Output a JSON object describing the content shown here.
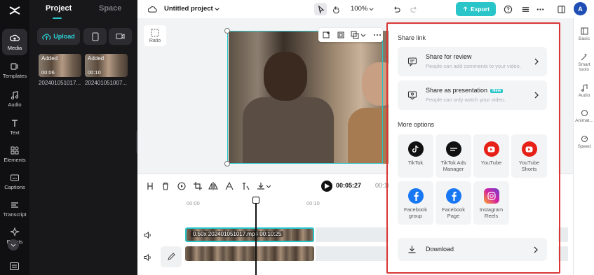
{
  "app": {
    "project_title": "Untitled project",
    "zoom": "100%",
    "export_label": "Export",
    "avatar_letter": "A"
  },
  "rail": [
    {
      "label": "Media",
      "icon": "cloud-upload-icon",
      "active": true
    },
    {
      "label": "Templates",
      "icon": "templates-icon"
    },
    {
      "label": "Audio",
      "icon": "music-icon"
    },
    {
      "label": "Text",
      "icon": "text-icon"
    },
    {
      "label": "Elements",
      "icon": "elements-icon"
    },
    {
      "label": "Captions",
      "icon": "captions-icon"
    },
    {
      "label": "Transcript",
      "icon": "transcript-icon"
    },
    {
      "label": "Effects",
      "icon": "effects-icon"
    }
  ],
  "panel": {
    "tabs": [
      "Project",
      "Space"
    ],
    "upload_label": "Upload",
    "clips": [
      {
        "badge": "Added",
        "duration": "00:06",
        "name": "202401051017..."
      },
      {
        "badge": "Added",
        "duration": "00:10",
        "name": "202401051007..."
      }
    ]
  },
  "canvas": {
    "ratio_label": "Ratio"
  },
  "player": {
    "current_time": "00:05:27",
    "total_time": "00:10:2"
  },
  "timeline": {
    "ruler": [
      "00:00",
      "00:10"
    ],
    "main_clip_label": "0.50x  202401051017.mp4  00:10:25"
  },
  "right_rail": [
    {
      "label": "Basic",
      "icon": "basic-icon"
    },
    {
      "label": "Smart tools",
      "icon": "smart-tools-icon"
    },
    {
      "label": "Audio",
      "icon": "audio-icon"
    },
    {
      "label": "Animat...",
      "icon": "animation-icon"
    },
    {
      "label": "Speed",
      "icon": "speed-icon"
    }
  ],
  "export_menu": {
    "share_title": "Share link",
    "share_items": [
      {
        "title": "Share for review",
        "subtitle": "People can add comments to your video.",
        "badge": ""
      },
      {
        "title": "Share as presentation",
        "subtitle": "People can only watch your video.",
        "badge": "New"
      }
    ],
    "more_title": "More options",
    "options": [
      {
        "label": "TikTok",
        "icon": "tiktok-icon",
        "color": "#111111"
      },
      {
        "label": "TikTok Ads Manager",
        "icon": "tiktok-ads-icon",
        "color": "#111111"
      },
      {
        "label": "YouTube",
        "icon": "youtube-icon",
        "color": "#e62117"
      },
      {
        "label": "YouTube Shorts",
        "icon": "youtube-shorts-icon",
        "color": "#e62117"
      },
      {
        "label": "Facebook group",
        "icon": "facebook-icon",
        "color": "#1877f2"
      },
      {
        "label": "Facebook Page",
        "icon": "facebook-icon",
        "color": "#1877f2"
      },
      {
        "label": "Instagram Reels",
        "icon": "instagram-icon",
        "color": "#d6249f"
      }
    ],
    "download_label": "Download"
  },
  "colors": {
    "accent": "#29c5c9",
    "highlight": "#d93636"
  }
}
